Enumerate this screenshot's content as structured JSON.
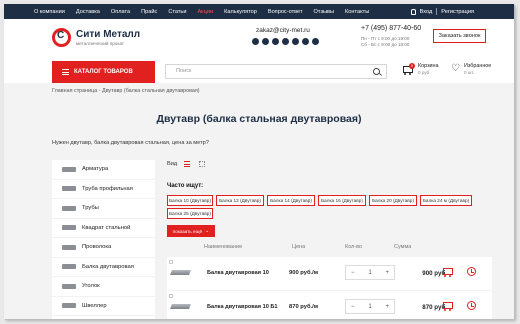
{
  "topbar": {
    "nav": [
      "О компании",
      "Доставка",
      "Оплата",
      "Прайс",
      "Статьи",
      "Акции",
      "Калькулятор",
      "Вопрос-ответ",
      "Отзывы",
      "Контакты"
    ],
    "active_index": 5,
    "login": "Вход",
    "register": "Регистрация"
  },
  "header": {
    "logo_name": "Сити Металл",
    "logo_sub": "металлический прокат",
    "email": "zakaz@city-met.ru",
    "phone": "+7 (495) 877-40-60",
    "hours": [
      "Пн - Пт с 9:00 до 19:00",
      "Сб - Вс с 9:00 до 18:00"
    ],
    "callback": "Заказать звонок"
  },
  "nav": {
    "catalog": "КАТАЛОГ ТОВАРОВ",
    "search_placeholder": "Поиск",
    "cart_label": "Корзина",
    "cart_sum": "0 руб.",
    "cart_count": "0",
    "fav_label": "Избранное",
    "fav_count": "0 шт."
  },
  "breadcrumbs": "Главная страница - Двутавр (балка стальная двутавровая)",
  "page_title": "Двутавр (балка стальная двутавровая)",
  "intro": "Нужен двутавр, балка двутавровая стальная, цена за метр?",
  "sidebar": [
    "Арматура",
    "Труба профильная",
    "Трубы",
    "Квадрат стальной",
    "Проволока",
    "Балка двутавровая",
    "Уголок",
    "Швеллер"
  ],
  "view_label": "Вид",
  "often": {
    "title": "Часто ищут:",
    "chips": [
      "Балка 10 (Двутавр)",
      "Балка 12 (Двутавр)",
      "Балка 14 (Двутавр)",
      "Балка 16 (Двутавр)",
      "Балка 20 (Двутавр)",
      "Балка 24 м (Двутавр)",
      "Балка 25 (Двутавр)"
    ],
    "more": "показать ещё"
  },
  "table": {
    "headers": {
      "name": "Наименование",
      "price": "Цена",
      "qty": "Кол-во",
      "sum": "Сумма"
    },
    "rows": [
      {
        "name": "Балка двутавровая 10",
        "price": "900 руб./м",
        "qty": "1",
        "sum": "900 руб."
      },
      {
        "name": "Балка двутавровая 10 Б1",
        "price": "870 руб./м",
        "qty": "1",
        "sum": "870 руб."
      }
    ],
    "minus": "−",
    "plus": "+"
  }
}
